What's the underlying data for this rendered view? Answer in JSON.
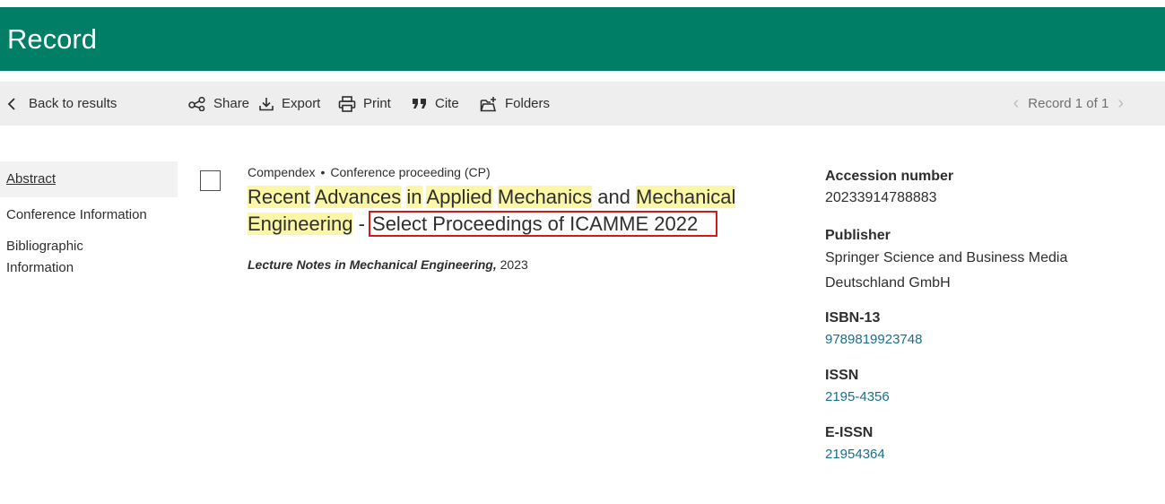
{
  "header": {
    "title": "Record"
  },
  "toolbar": {
    "back": "Back to results",
    "share": "Share",
    "export": "Export",
    "print": "Print",
    "cite": "Cite",
    "folders": "Folders",
    "record_nav": "Record 1 of 1"
  },
  "sidebar": {
    "items": [
      {
        "label": "Abstract"
      },
      {
        "label": "Conference Information"
      },
      {
        "label": "Bibliographic Information"
      }
    ]
  },
  "record": {
    "database": "Compendex",
    "doc_type": "Conference proceeding (CP)",
    "title_parts": [
      "Recent",
      "Advances",
      "in",
      "Applied",
      "Mechanics",
      "and",
      "Mechanical",
      "Engineering",
      "-",
      "Select Proceedings of ICAMME 2022"
    ],
    "source_title": "Lecture Notes in Mechanical Engineering,",
    "source_year": "2023"
  },
  "details": {
    "accession_label": "Accession number",
    "accession_value": "20233914788883",
    "publisher_label": "Publisher",
    "publisher_value": "Springer Science and Business Media Deutschland GmbH",
    "isbn_label": "ISBN-13",
    "isbn_value": "9789819923748",
    "issn_label": "ISSN",
    "issn_value": "2195-4356",
    "eissn_label": "E-ISSN",
    "eissn_value": "21954364"
  },
  "colors": {
    "header_bg": "#007f66",
    "highlight": "#fbf7a6",
    "link": "#1a6f89",
    "annotation_box": "#d21a1a"
  }
}
